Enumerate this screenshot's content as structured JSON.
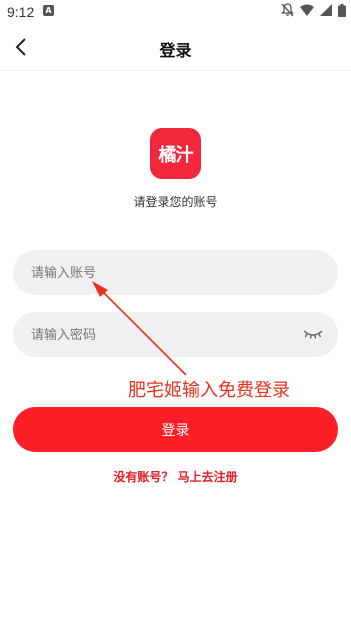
{
  "status_bar": {
    "time": "9:12",
    "notification_letter": "A"
  },
  "header": {
    "title": "登录"
  },
  "logo": {
    "text": "橘汁",
    "color": "#f1283b"
  },
  "subtitle": "请登录您的账号",
  "form": {
    "account": {
      "placeholder": "请输入账号",
      "value": ""
    },
    "password": {
      "placeholder": "请输入密码",
      "value": ""
    },
    "login_label": "登录",
    "register_link": "没有账号？ 马上去注册"
  },
  "annotation": {
    "text": "肥宅姬输入免费登录",
    "color": "#e8301f"
  },
  "colors": {
    "accent": "#fc1f26",
    "link": "#e21d24",
    "field_bg": "#f0f0f0"
  },
  "icons": [
    "back-arrow-icon",
    "eye-closed-icon",
    "mute-icon",
    "wifi-icon",
    "signal-icon",
    "battery-icon"
  ]
}
